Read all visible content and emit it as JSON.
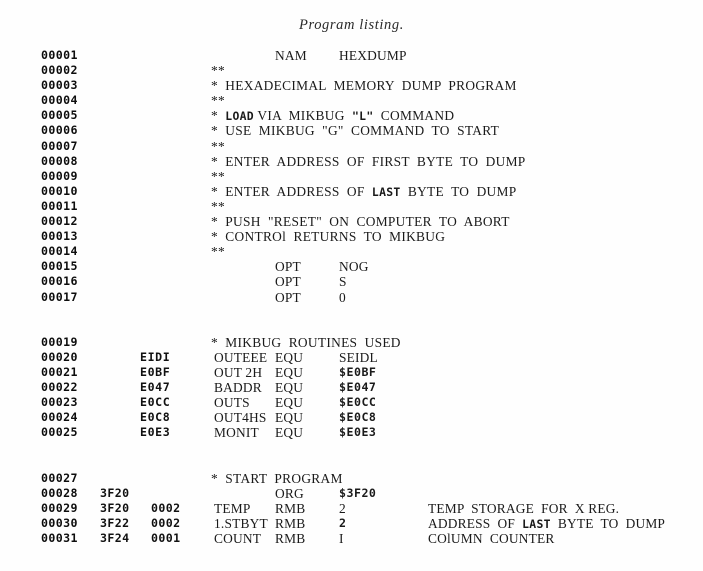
{
  "caption": "Program listing.",
  "listing": {
    "rows": [
      {
        "lineno": "00001",
        "addr": "",
        "obj": "",
        "label": "",
        "op": "NAM",
        "operand": "HEXDUMP",
        "comment": ""
      },
      {
        "lineno": "00002",
        "free": "**"
      },
      {
        "lineno": "00003",
        "free": "*  HEXADECIMAL  MEMORY  DUMP  PROGRAM"
      },
      {
        "lineno": "00004",
        "free": "**"
      },
      {
        "lineno": "00005",
        "free": "*  LOAD VIA MIKBUG \"L\" COMMAND",
        "free_parts": [
          {
            "t": "*",
            "b": false
          },
          {
            "t": "  ",
            "b": false
          },
          {
            "t": "LOAD",
            "b": true
          },
          {
            "t": " VIA  MIKBUG  ",
            "b": false
          },
          {
            "t": "\"L\"",
            "b": true
          },
          {
            "t": "  COMMAND",
            "b": false
          }
        ]
      },
      {
        "lineno": "00006",
        "free": "*  USE  MIKBUG  \"G\"  COMMAND  TO  START"
      },
      {
        "lineno": "00007",
        "free": "**"
      },
      {
        "lineno": "00008",
        "free": "*  ENTER  ADDRESS  OF  FIRST  BYTE  TO  DUMP"
      },
      {
        "lineno": "00009",
        "free": "**"
      },
      {
        "lineno": "00010",
        "free": "*  ENTER  ADDRESS  OF  LAST  BYTE  TO  DUMP",
        "free_parts": [
          {
            "t": "*",
            "b": false
          },
          {
            "t": "  ENTER  ADDRESS  OF  ",
            "b": false
          },
          {
            "t": "LAST",
            "b": true
          },
          {
            "t": "  BYTE  TO  DUMP",
            "b": false
          }
        ]
      },
      {
        "lineno": "00011",
        "free": "**"
      },
      {
        "lineno": "00012",
        "free": "*  PUSH  \"RESET\"  ON  COMPUTER  TO  ABORT"
      },
      {
        "lineno": "00013",
        "free": "*  CONTROl  RETURNS  TO  MIKBUG"
      },
      {
        "lineno": "00014",
        "free": "**"
      },
      {
        "lineno": "00015",
        "addr": "",
        "obj": "",
        "label": "",
        "op": "OPT",
        "operand": "NOG",
        "comment": ""
      },
      {
        "lineno": "00016",
        "addr": "",
        "obj": "",
        "label": "",
        "op": "OPT",
        "operand": "S",
        "comment": ""
      },
      {
        "lineno": "00017",
        "addr": "",
        "obj": "",
        "label": "",
        "op": "OPT",
        "operand": "0",
        "comment": ""
      },
      {
        "spacer": true
      },
      {
        "spacer": true
      },
      {
        "lineno": "00019",
        "free": "*  MIKBUG  ROUTINES  USED"
      },
      {
        "lineno": "00020",
        "equval": "EIDI",
        "label": "OUTEEE",
        "op": "EQU",
        "operand": "SEIDL",
        "comment": ""
      },
      {
        "lineno": "00021",
        "equval": "E0BF",
        "label": "OUT 2H",
        "op": "EQU",
        "operand": "$E0BF",
        "mono": true,
        "comment": ""
      },
      {
        "lineno": "00022",
        "equval": "E047",
        "label": "BADDR",
        "op": "EQU",
        "operand": "$E047",
        "mono": true,
        "comment": ""
      },
      {
        "lineno": "00023",
        "equval": "E0CC",
        "label": "OUTS",
        "op": "EQU",
        "operand": "$E0CC",
        "mono": true,
        "comment": ""
      },
      {
        "lineno": "00024",
        "equval": "E0C8",
        "label": "OUT4HS",
        "op": "EQU",
        "operand": "$E0C8",
        "mono": true,
        "comment": ""
      },
      {
        "lineno": "00025",
        "equval": "E0E3",
        "label": "MONIT",
        "op": "EQU",
        "operand": "$E0E3",
        "mono": true,
        "comment": ""
      },
      {
        "spacer": true
      },
      {
        "spacer": true
      },
      {
        "lineno": "00027",
        "free": "*  START  PROGRAM"
      },
      {
        "lineno": "00028",
        "addr": "3F20",
        "obj": "",
        "label": "",
        "op": "ORG",
        "operand": "$3F20",
        "mono": true,
        "comment": ""
      },
      {
        "lineno": "00029",
        "addr": "3F20",
        "obj": "0002",
        "label": "TEMP",
        "op": "RMB",
        "operand": "2",
        "comment": "TEMP  STORAGE  FOR  X REG."
      },
      {
        "lineno": "00030",
        "addr": "3F22",
        "obj": "0002",
        "label": "1.STBYT",
        "op": "RMB",
        "operand": "2",
        "mono": true,
        "comment": "ADDRESS  OF  LAST  BYTE  TO  DUMP",
        "comment_parts": [
          {
            "t": "ADDRESS  OF  ",
            "b": false
          },
          {
            "t": "LAST",
            "b": true
          },
          {
            "t": "  BYTE  TO  DUMP",
            "b": false
          }
        ]
      },
      {
        "lineno": "00031",
        "addr": "3F24",
        "obj": "0001",
        "label": "COUNT",
        "op": "RMB",
        "operand": "I",
        "comment": "COlUMN  COUNTER"
      }
    ]
  }
}
